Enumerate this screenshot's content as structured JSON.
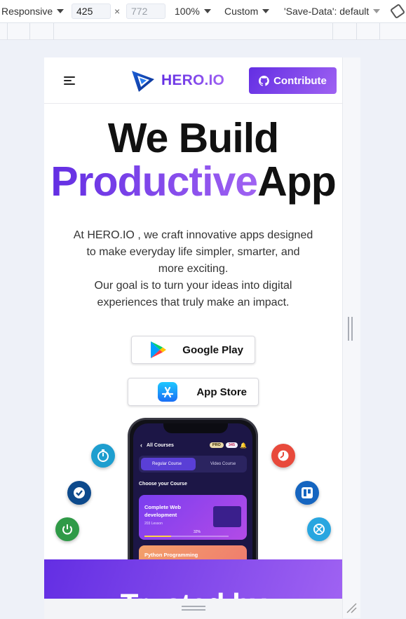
{
  "devtools": {
    "device_mode": "Responsive",
    "width": "425",
    "height_placeholder": "772",
    "zoom": "100%",
    "throttle": "Custom",
    "save_data": "'Save-Data': default"
  },
  "site": {
    "nav": {
      "brand": "HERO.IO",
      "contribute_label": "Contribute"
    },
    "hero": {
      "title_line1": "We Build",
      "title_highlight": "Productive",
      "title_rest": "App",
      "desc_line1": "At HERO.IO , we craft innovative apps designed to make everyday life simpler, smarter, and more exciting.",
      "desc_line2": "Our goal is to turn your ideas into digital experiences that truly make an impact."
    },
    "stores": {
      "google_play": "Google Play",
      "app_store": "App Store"
    },
    "phone": {
      "header": "All Courses",
      "pro_badge": "PRO",
      "hearts": "345",
      "tab_regular": "Regular Course",
      "tab_video": "Video Course",
      "choose": "Choose your Course",
      "card1_title": "Complete Web development",
      "card1_lessons": "203 Lesson",
      "card1_progress": "32%",
      "card2_title": "Python Programming"
    },
    "trusted_heading": "Trusted by"
  },
  "colors": {
    "brand_start": "#632ee3",
    "brand_end": "#9f62f2"
  },
  "icons": {
    "floating": [
      "stopwatch-icon",
      "check-icon",
      "power-icon",
      "clock-icon",
      "trello-icon",
      "timer-icon"
    ]
  }
}
